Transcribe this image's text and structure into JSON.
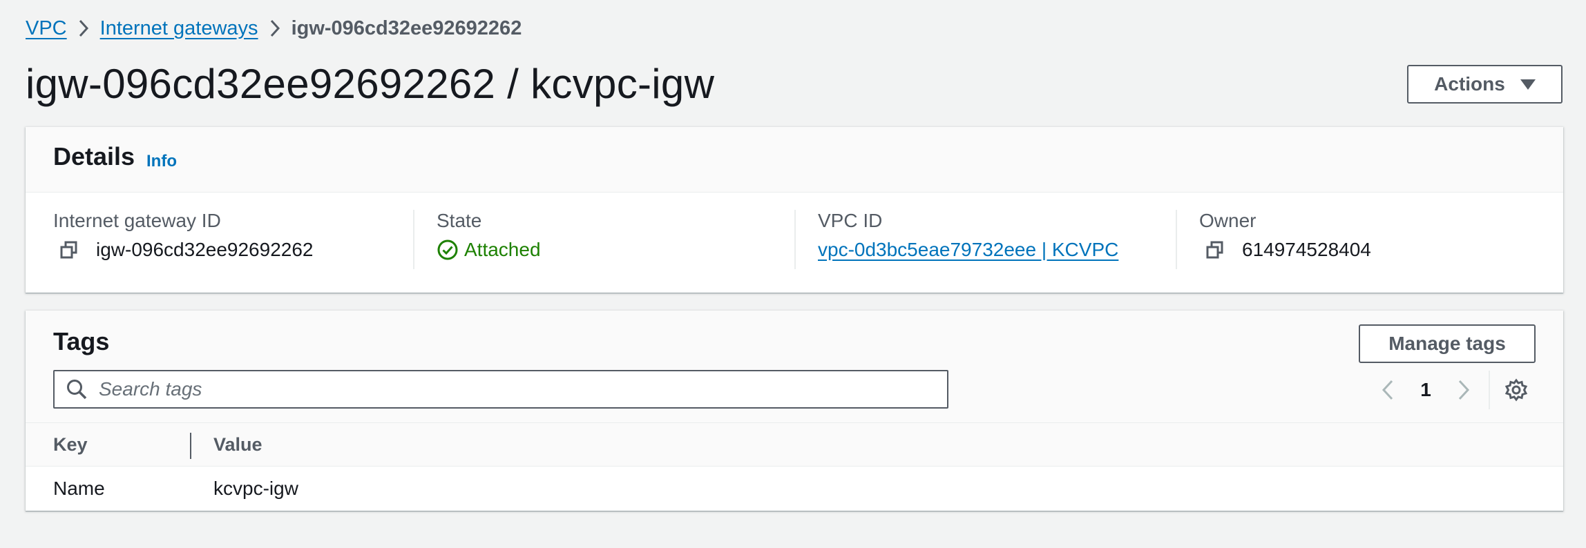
{
  "breadcrumb": {
    "items": [
      "VPC",
      "Internet gateways"
    ],
    "current": "igw-096cd32ee92692262"
  },
  "header": {
    "title": "igw-096cd32ee92692262 / kcvpc-igw",
    "actions_label": "Actions"
  },
  "details": {
    "title": "Details",
    "info_label": "Info",
    "fields": [
      {
        "label": "Internet gateway ID",
        "value": "igw-096cd32ee92692262",
        "icon": "copy-icon"
      },
      {
        "label": "State",
        "value": "Attached",
        "icon": "check-circle-icon"
      },
      {
        "label": "VPC ID",
        "value": "vpc-0d3bc5eae79732eee | KCVPC"
      },
      {
        "label": "Owner",
        "value": "614974528404",
        "icon": "copy-icon"
      }
    ]
  },
  "tags": {
    "title": "Tags",
    "manage_label": "Manage tags",
    "search_placeholder": "Search tags",
    "page": "1",
    "columns": [
      "Key",
      "Value"
    ],
    "rows": [
      {
        "key": "Name",
        "value": "kcvpc-igw"
      }
    ]
  },
  "colors": {
    "link": "#0073bb",
    "success": "#1d8102",
    "background": "#f2f3f3",
    "text": "#16191f",
    "secondary_text": "#545b64"
  }
}
